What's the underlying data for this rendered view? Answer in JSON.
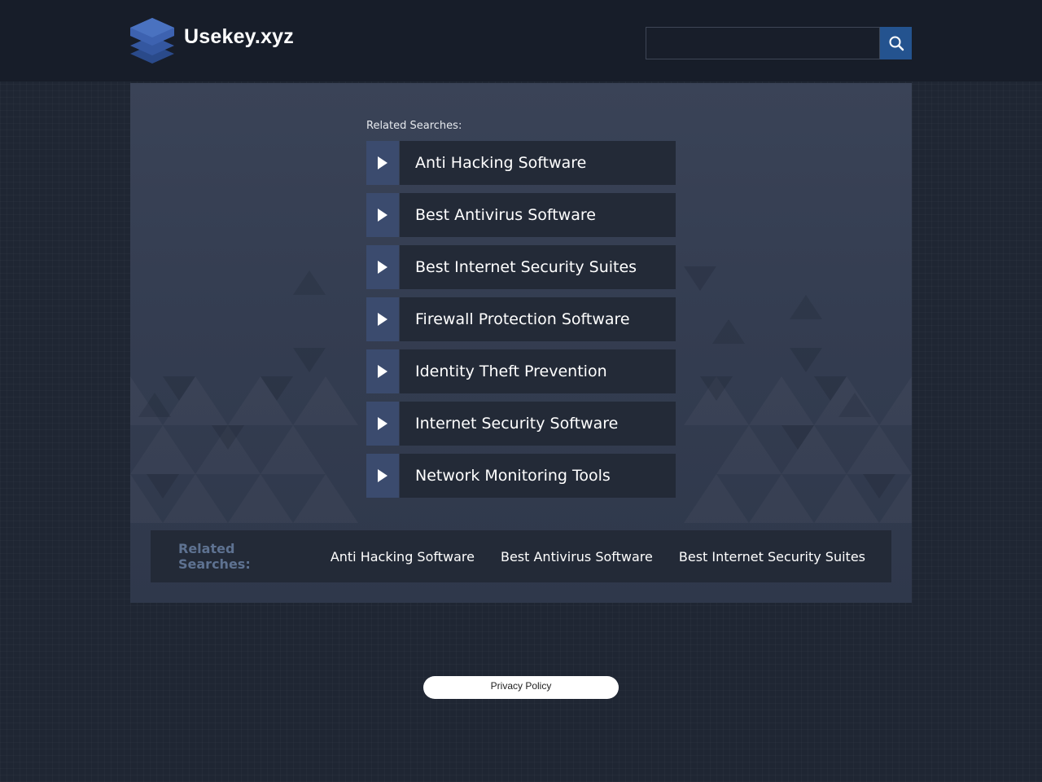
{
  "header": {
    "site_name": "Usekey.xyz",
    "logo_icon": "stacked-layers-icon",
    "search": {
      "placeholder": "",
      "value": "",
      "button_icon": "search-icon"
    }
  },
  "main": {
    "related_label": "Related Searches:",
    "links": [
      {
        "label": "Anti Hacking Software"
      },
      {
        "label": "Best Antivirus Software"
      },
      {
        "label": "Best Internet Security Suites"
      },
      {
        "label": "Firewall Protection Software"
      },
      {
        "label": "Identity Theft Prevention"
      },
      {
        "label": "Internet Security Software"
      },
      {
        "label": "Network Monitoring Tools"
      }
    ],
    "link_icon": "play-arrow-icon"
  },
  "footer_bar": {
    "label": "Related Searches:",
    "links": [
      {
        "label": "Anti Hacking Software"
      },
      {
        "label": "Best Antivirus Software"
      },
      {
        "label": "Best Internet Security Suites"
      }
    ]
  },
  "privacy": {
    "label": "Privacy Policy"
  },
  "colors": {
    "header_bg": "#171d29",
    "page_bg": "#1f2633",
    "panel_bg": "#3a4357",
    "link_bg": "#232a37",
    "arrow_bg": "#3b4b6e",
    "search_button_bg": "#24538f",
    "footer_label": "#5e7291"
  }
}
